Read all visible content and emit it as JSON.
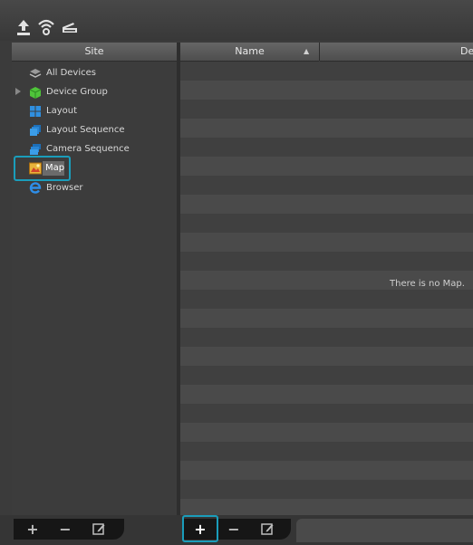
{
  "toolbar": {
    "icons": [
      "upload-icon",
      "wireless-icon",
      "scanner-icon"
    ]
  },
  "site_panel": {
    "header": "Site",
    "items": [
      {
        "label": "All Devices",
        "icon": "all-devices-icon"
      },
      {
        "label": "Device Group",
        "icon": "device-group-icon"
      },
      {
        "label": "Layout",
        "icon": "layout-icon"
      },
      {
        "label": "Layout Sequence",
        "icon": "layout-sequence-icon"
      },
      {
        "label": "Camera Sequence",
        "icon": "camera-sequence-icon"
      },
      {
        "label": "Map",
        "icon": "map-icon"
      },
      {
        "label": "Browser",
        "icon": "browser-icon"
      }
    ],
    "selected": "Map"
  },
  "list_panel": {
    "columns": [
      "Name",
      "De"
    ],
    "sort_indicator": "▲",
    "empty_message": "There is no Map."
  },
  "left_buttons": {
    "add": "+",
    "remove": "−",
    "edit": "edit-icon"
  },
  "right_buttons": {
    "add": "+",
    "remove": "−",
    "edit": "edit-icon"
  },
  "colors": {
    "accent": "#1a9dbb",
    "background": "#3b3b3b"
  }
}
